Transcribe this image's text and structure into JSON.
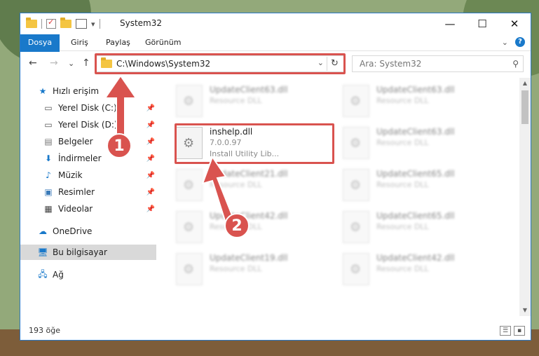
{
  "window": {
    "title": "System32",
    "controls": {
      "minimize": "—",
      "maximize": "☐",
      "close": "✕"
    }
  },
  "ribbon": {
    "tabs": [
      "Dosya",
      "Giriş",
      "Paylaş",
      "Görünüm"
    ],
    "expand": "⌄",
    "help": "?"
  },
  "address": {
    "path": "C:\\Windows\\System32",
    "dropdown": "⌄",
    "refresh": "↻"
  },
  "search": {
    "placeholder": "Ara: System32"
  },
  "navigation": {
    "back": "←",
    "forward": "→",
    "recent": "⌄",
    "up": "↑"
  },
  "sidebar": {
    "items": [
      {
        "label": "Hızlı erişim",
        "icon": "star-icon"
      },
      {
        "label": "Yerel Disk (C:)",
        "icon": "drive-icon"
      },
      {
        "label": "Yerel Disk (D:)",
        "icon": "drive-icon"
      },
      {
        "label": "Belgeler",
        "icon": "documents-icon"
      },
      {
        "label": "İndirmeler",
        "icon": "download-icon"
      },
      {
        "label": "Müzik",
        "icon": "music-icon"
      },
      {
        "label": "Resimler",
        "icon": "pictures-icon"
      },
      {
        "label": "Videolar",
        "icon": "video-icon"
      },
      {
        "label": "OneDrive",
        "icon": "cloud-icon"
      },
      {
        "label": "Bu bilgisayar",
        "icon": "computer-icon"
      },
      {
        "label": "Ağ",
        "icon": "network-icon"
      }
    ],
    "pin_glyph": "📌"
  },
  "files": [
    {
      "name": "UpdateClient63.dll",
      "type": "Resource DLL",
      "extra": ""
    },
    {
      "name": "UpdateClient63.dll",
      "type": "Resource DLL",
      "extra": ""
    },
    {
      "name": "inshelp.dll",
      "type": "7.0.0.97",
      "extra": "Install Utility Lib..."
    },
    {
      "name": "UpdateClient63.dll",
      "type": "Resource DLL",
      "extra": ""
    },
    {
      "name": "UpdateClient21.dll",
      "type": "Resource DLL",
      "extra": ""
    },
    {
      "name": "UpdateClient65.dll",
      "type": "Resource DLL",
      "extra": ""
    },
    {
      "name": "UpdateClient42.dll",
      "type": "Resource DLL",
      "extra": ""
    },
    {
      "name": "UpdateClient65.dll",
      "type": "Resource DLL",
      "extra": ""
    },
    {
      "name": "UpdateClient19.dll",
      "type": "Resource DLL",
      "extra": ""
    },
    {
      "name": "UpdateClient42.dll",
      "type": "Resource DLL",
      "extra": ""
    }
  ],
  "status": {
    "count": "193 öğe"
  },
  "steps": {
    "one": "1",
    "two": "2"
  },
  "colors": {
    "accent": "#1979ca",
    "highlight": "#d9534f",
    "folder": "#f4c542"
  }
}
